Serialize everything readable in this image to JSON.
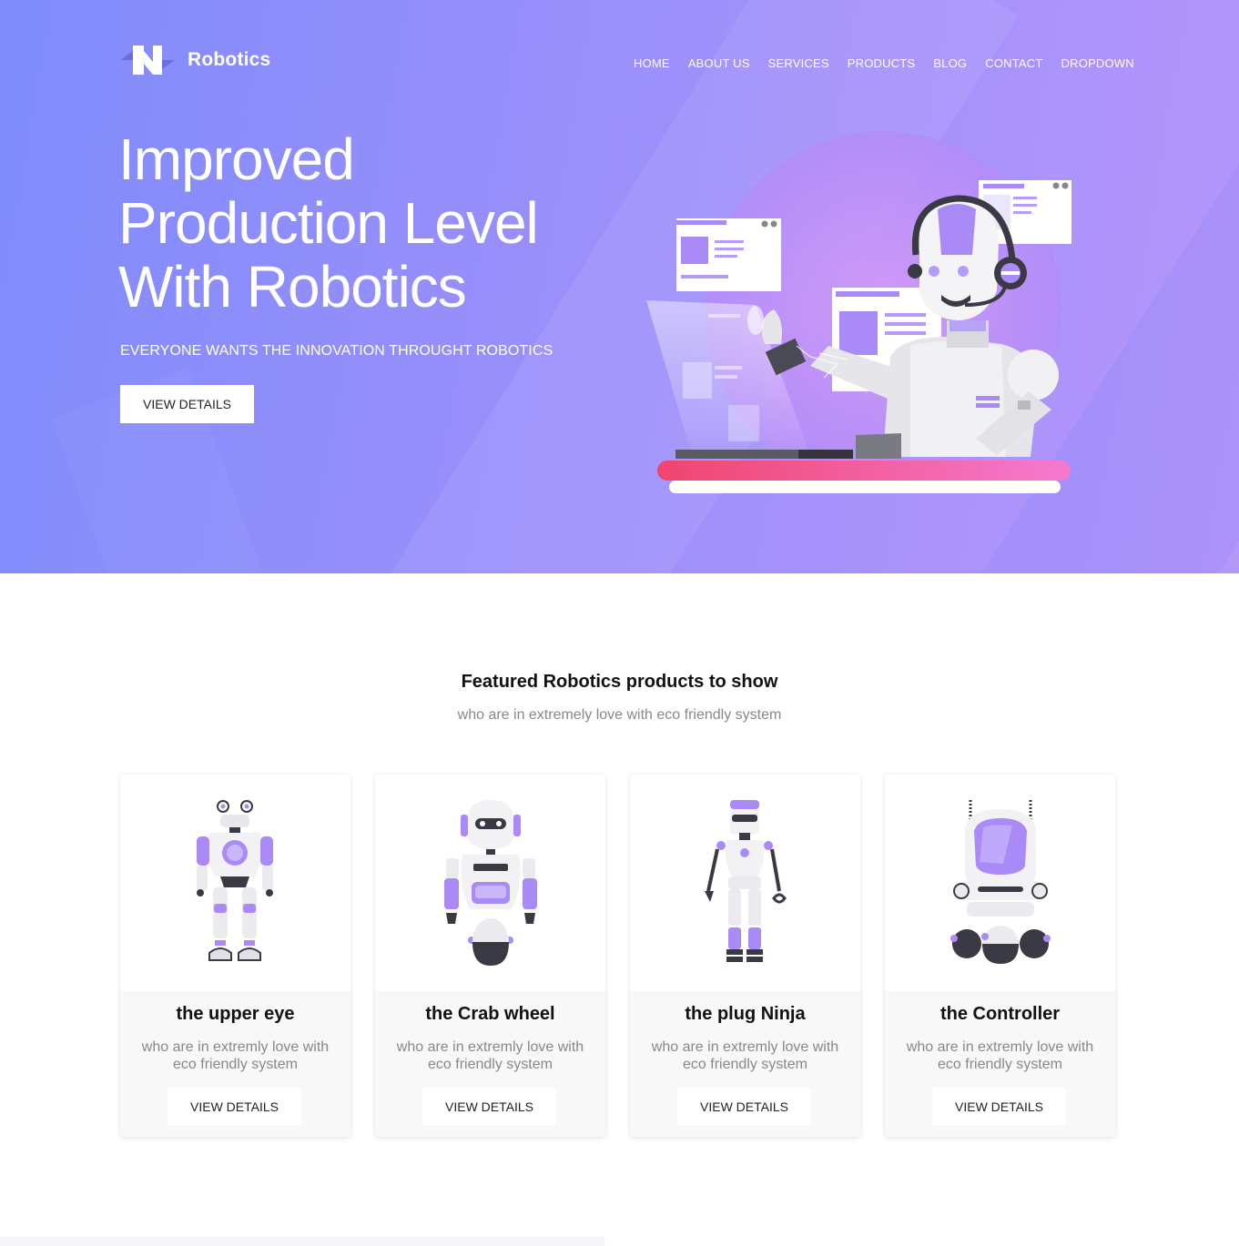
{
  "brand": {
    "name": "Robotics"
  },
  "nav": {
    "items": [
      "HOME",
      "ABOUT US",
      "SERVICES",
      "PRODUCTS",
      "BLOG",
      "CONTACT",
      "DROPDOWN"
    ]
  },
  "hero": {
    "title_line1": "Improved",
    "title_line2": "Production Level",
    "title_line3": "With Robotics",
    "subtitle": "EVERYONE WANTS THE INNOVATION THROUGHT ROBOTICS",
    "button_label": "VIEW DETAILS"
  },
  "featured": {
    "title": "Featured Robotics products to show",
    "subtitle": "who are in extremely love with eco friendly system",
    "products": [
      {
        "name": "the upper eye",
        "desc": "who are in extremly love with eco friendly system",
        "button_label": "VIEW DETAILS"
      },
      {
        "name": "the Crab wheel",
        "desc": "who are in extremly love with eco friendly system",
        "button_label": "VIEW DETAILS"
      },
      {
        "name": "the plug Ninja",
        "desc": "who are in extremly love with eco friendly system",
        "button_label": "VIEW DETAILS"
      },
      {
        "name": "the Controller",
        "desc": "who are in extremly love with eco friendly system",
        "button_label": "VIEW DETAILS"
      }
    ]
  },
  "colors": {
    "hero_start": "#7f8cfb",
    "hero_end": "#b596f9",
    "accent_purple": "#a58bf7",
    "desk_pink": "#f0456e"
  }
}
